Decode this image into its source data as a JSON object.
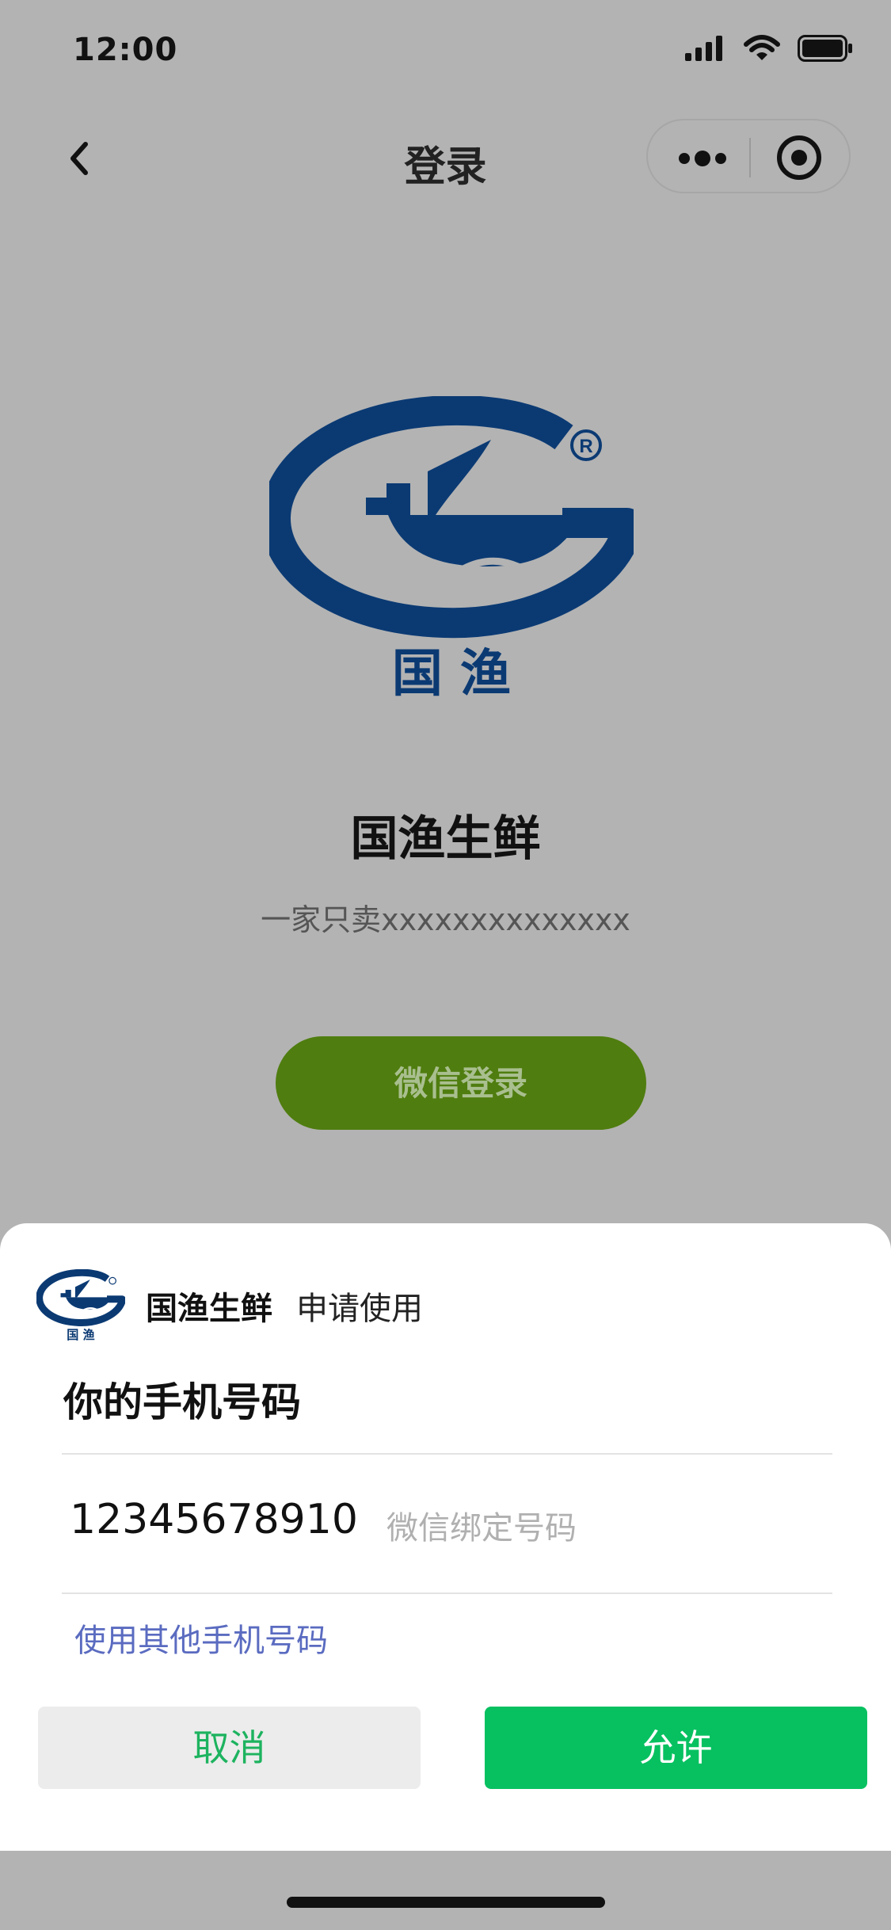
{
  "status_bar": {
    "time": "12:00"
  },
  "nav": {
    "title": "登录"
  },
  "brand": {
    "name": "国渔生鲜",
    "slogan": "一家只卖xxxxxxxxxxxxxx",
    "logo_text": "国 渔",
    "logo_mark": "®",
    "color": "#0b3a73"
  },
  "main": {
    "wechat_login_label": "微信登录",
    "wechat_login_color": "#4f7d0f"
  },
  "sheet": {
    "app_name": "国渔生鲜",
    "request_label": "申请使用",
    "title": "你的手机号码",
    "phone_number": "12345678910",
    "phone_hint": "微信绑定号码",
    "other_phone_link": "使用其他手机号码",
    "cancel_label": "取消",
    "allow_label": "允许",
    "allow_color": "#07c160"
  }
}
